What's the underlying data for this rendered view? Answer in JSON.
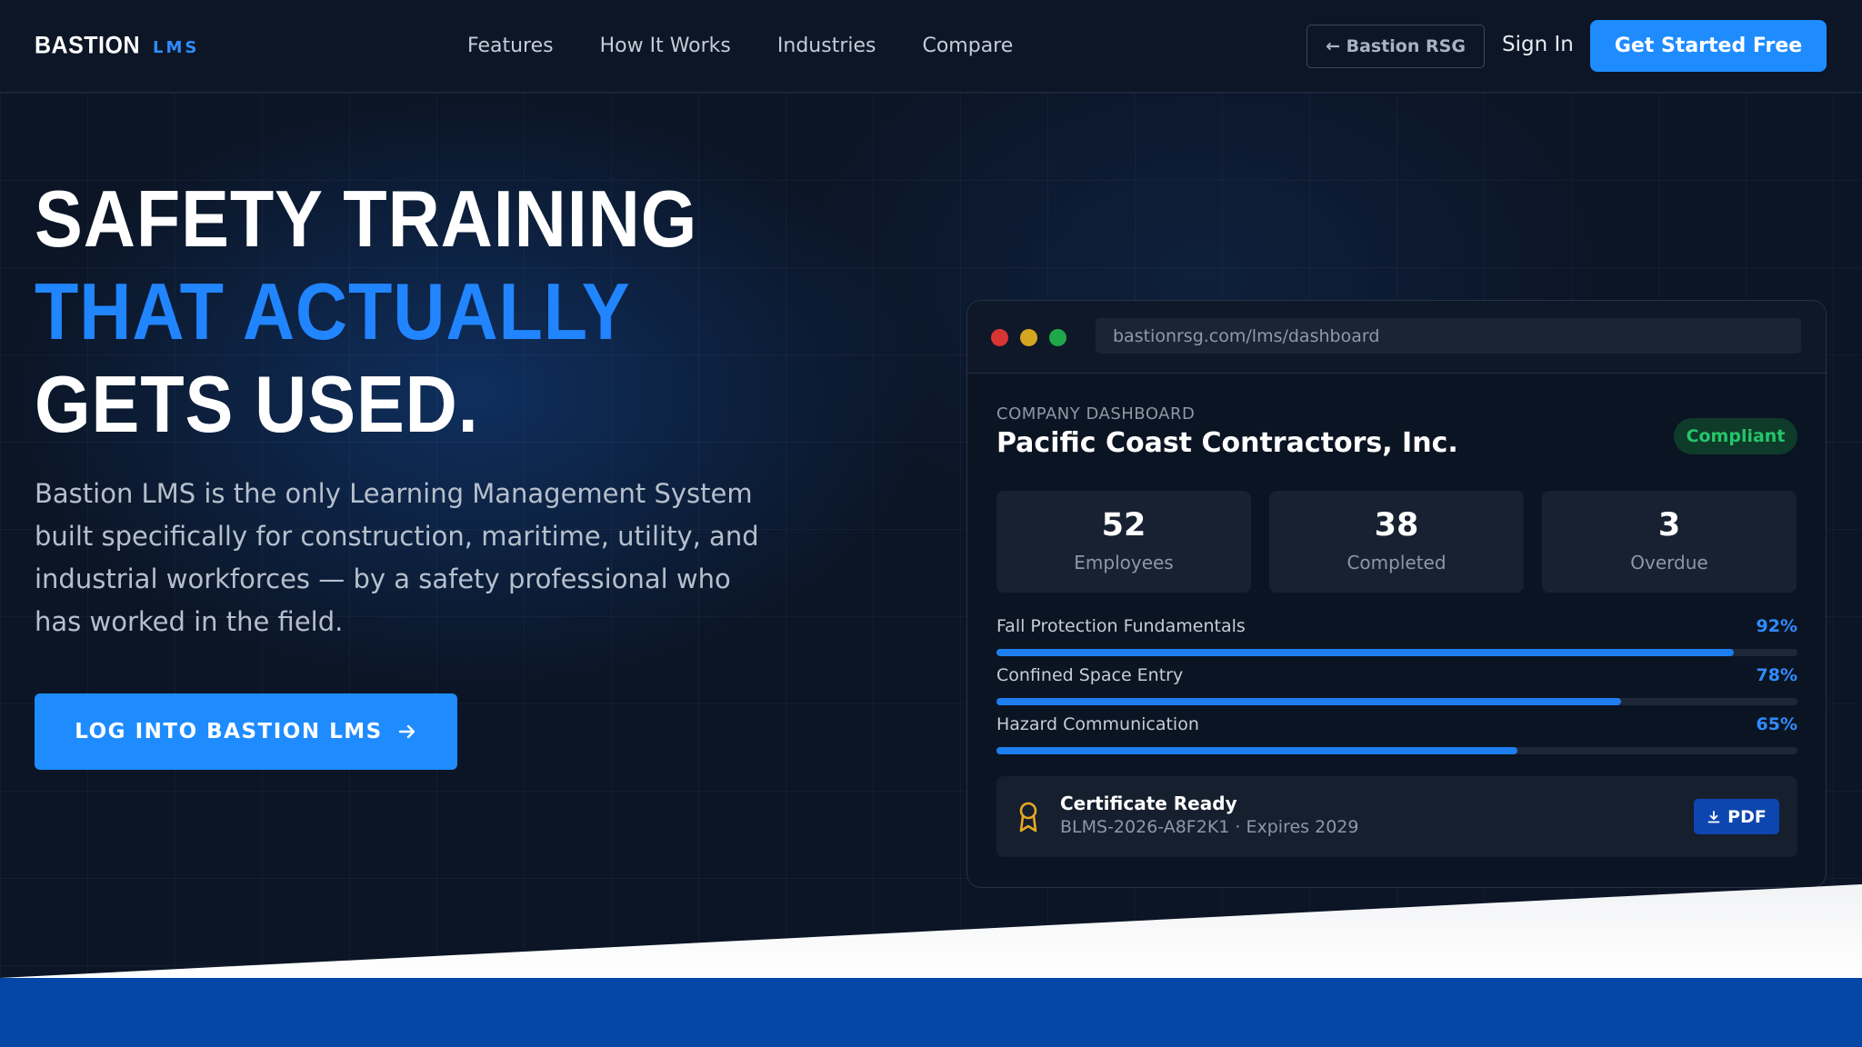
{
  "header": {
    "logo_name": "BASTION",
    "logo_sub": "LMS",
    "nav": [
      "Features",
      "How It Works",
      "Industries",
      "Compare"
    ],
    "back_button": "← Bastion RSG",
    "sign_in": "Sign In",
    "cta": "Get Started Free"
  },
  "hero": {
    "headline_line1": "SAFETY TRAINING",
    "headline_line2": "THAT ACTUALLY",
    "headline_line3": "GETS USED.",
    "subtext": "Bastion LMS is the only Learning Management System built specifically for construction, maritime, utility, and industrial workforces — by a safety professional who has worked in the field.",
    "login_button": "LOG INTO BASTION LMS"
  },
  "dashboard": {
    "url": "bastionrsg.com/lms/dashboard",
    "label": "COMPANY DASHBOARD",
    "company": "Pacific Coast Contractors, Inc.",
    "status_badge": "Compliant",
    "stats": [
      {
        "value": "52",
        "label": "Employees"
      },
      {
        "value": "38",
        "label": "Completed"
      },
      {
        "value": "3",
        "label": "Overdue"
      }
    ],
    "courses": [
      {
        "name": "Fall Protection Fundamentals",
        "percent": "92%",
        "progress": 92
      },
      {
        "name": "Confined Space Entry",
        "percent": "78%",
        "progress": 78
      },
      {
        "name": "Hazard Communication",
        "percent": "65%",
        "progress": 65
      }
    ],
    "certificate": {
      "title": "Certificate Ready",
      "detail": "BLMS-2026-A8F2K1 · Expires 2029",
      "button": "PDF"
    }
  },
  "colors": {
    "accent": "#1e8cff",
    "background": "#0b1526",
    "compliant": "#26c56a",
    "band": "#0447a6"
  }
}
